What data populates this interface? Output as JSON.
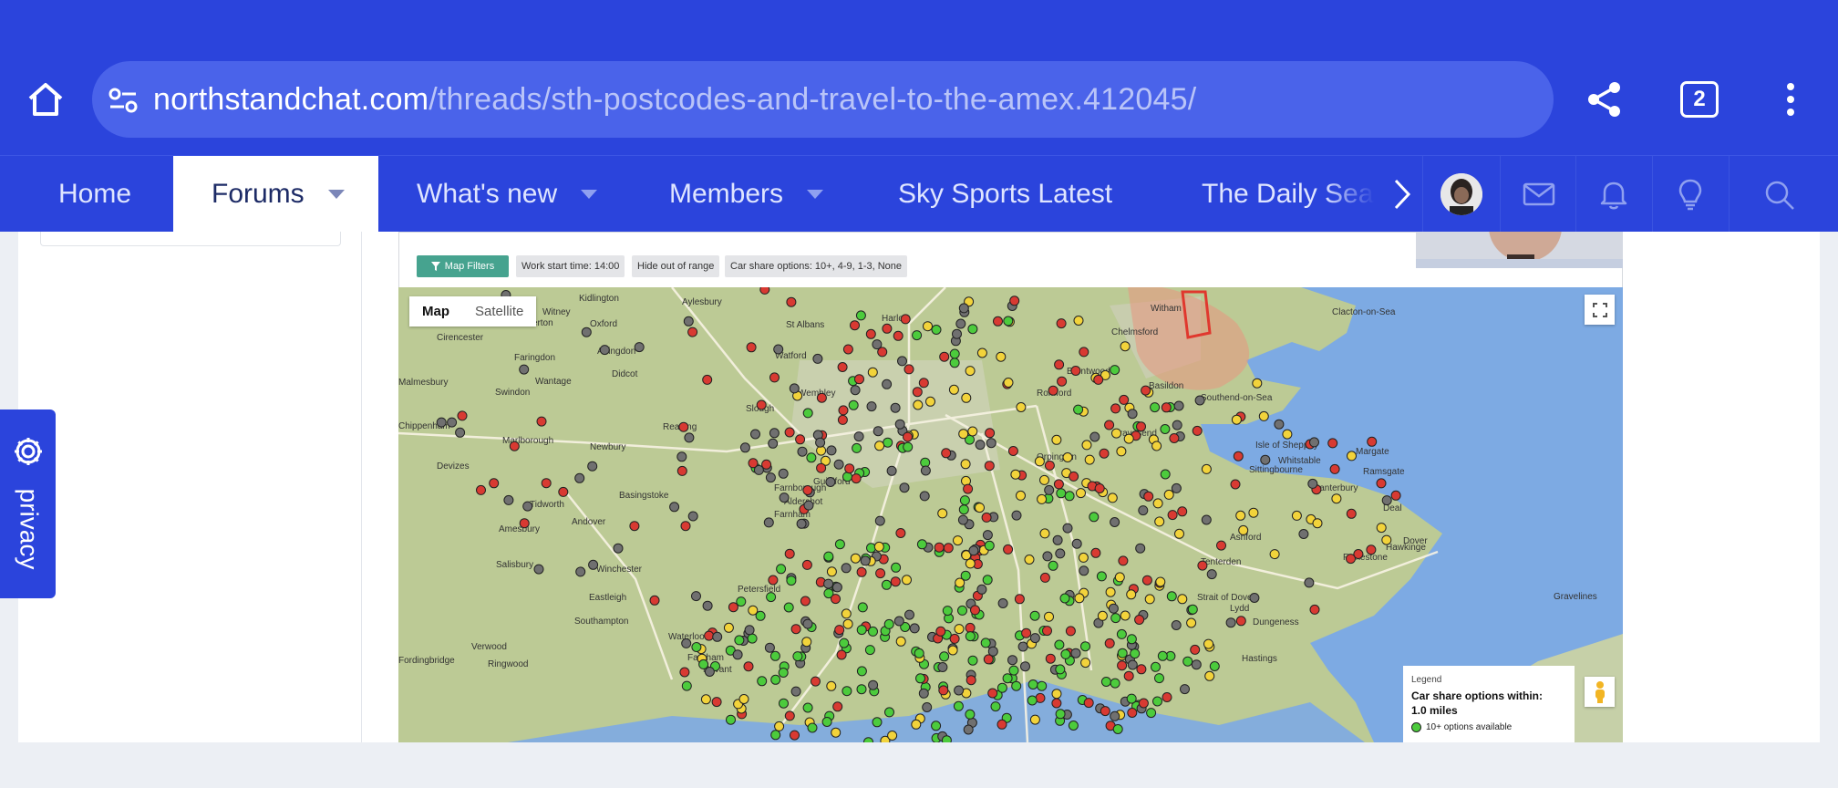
{
  "browser": {
    "url_domain": "northstandchat.com",
    "url_path": "/threads/sth-postcodes-and-travel-to-the-amex.412045/",
    "tab_count": "2"
  },
  "nav": {
    "tabs": [
      {
        "label": "Home"
      },
      {
        "label": "Forums"
      },
      {
        "label": "What's new"
      },
      {
        "label": "Members"
      },
      {
        "label": "Sky Sports Latest"
      },
      {
        "label": "The Daily Sea"
      }
    ]
  },
  "filters": {
    "map_filters": "Map Filters",
    "work_start": "Work start time: 14:00",
    "hide_out_of_range": "Hide out of range",
    "car_share": "Car share options: 10+, 4-9, 1-3, None"
  },
  "map": {
    "type_map": "Map",
    "type_satellite": "Satellite",
    "places": [
      {
        "name": "Kidlington"
      },
      {
        "name": "Aylesbury"
      },
      {
        "name": "Witney"
      },
      {
        "name": "Oxford"
      },
      {
        "name": "Carterton"
      },
      {
        "name": "St Albans"
      },
      {
        "name": "Harlow"
      },
      {
        "name": "Witham"
      },
      {
        "name": "Chelmsford"
      },
      {
        "name": "Clacton-on-Sea"
      },
      {
        "name": "Cirencester"
      },
      {
        "name": "Abingdon"
      },
      {
        "name": "Faringdon"
      },
      {
        "name": "Watford"
      },
      {
        "name": "Brentwood"
      },
      {
        "name": "Basildon"
      },
      {
        "name": "Southend-on-Sea"
      },
      {
        "name": "Malmesbury"
      },
      {
        "name": "Wantage"
      },
      {
        "name": "Didcot"
      },
      {
        "name": "Wembley"
      },
      {
        "name": "Romford"
      },
      {
        "name": "Swindon"
      },
      {
        "name": "Slough"
      },
      {
        "name": "Chippenham"
      },
      {
        "name": "Marlborough"
      },
      {
        "name": "Newbury"
      },
      {
        "name": "Reading"
      },
      {
        "name": "Gravesend"
      },
      {
        "name": "Isle of Sheppey"
      },
      {
        "name": "Margate"
      },
      {
        "name": "Devizes"
      },
      {
        "name": "Orpington"
      },
      {
        "name": "Sittingbourne"
      },
      {
        "name": "Whitstable"
      },
      {
        "name": "Ramsgate"
      },
      {
        "name": "Basingstoke"
      },
      {
        "name": "Farnborough"
      },
      {
        "name": "Aldershot"
      },
      {
        "name": "Guildford"
      },
      {
        "name": "Canterbury"
      },
      {
        "name": "Tidworth"
      },
      {
        "name": "Farnham"
      },
      {
        "name": "Deal"
      },
      {
        "name": "Andover"
      },
      {
        "name": "Amesbury"
      },
      {
        "name": "Ashford"
      },
      {
        "name": "Dover"
      },
      {
        "name": "Hawkinge"
      },
      {
        "name": "Folkestone"
      },
      {
        "name": "Tenterden"
      },
      {
        "name": "Salisbury"
      },
      {
        "name": "Winchester"
      },
      {
        "name": "Petersfield"
      },
      {
        "name": "Eastleigh"
      },
      {
        "name": "Strait of Dover"
      },
      {
        "name": "Lydd"
      },
      {
        "name": "Dungeness"
      },
      {
        "name": "Southampton"
      },
      {
        "name": "Waterlooville"
      },
      {
        "name": "Gravelines"
      },
      {
        "name": "Verwood"
      },
      {
        "name": "Ringwood"
      },
      {
        "name": "Hastings"
      },
      {
        "name": "Fareham"
      },
      {
        "name": "Havant"
      },
      {
        "name": "Fordingbridge"
      }
    ]
  },
  "legend": {
    "title": "Legend",
    "heading_line1": "Car share options within:",
    "heading_line2": "1.0 miles",
    "item1": "10+ options available"
  },
  "privacy": {
    "label": "privacy"
  },
  "colors": {
    "brand": "#2b44dc",
    "filter_button": "#46a38f",
    "dot_red": "#d83a32",
    "dot_yellow": "#f2d33b",
    "dot_green": "#4ccb3c",
    "dot_gray": "#707070"
  }
}
